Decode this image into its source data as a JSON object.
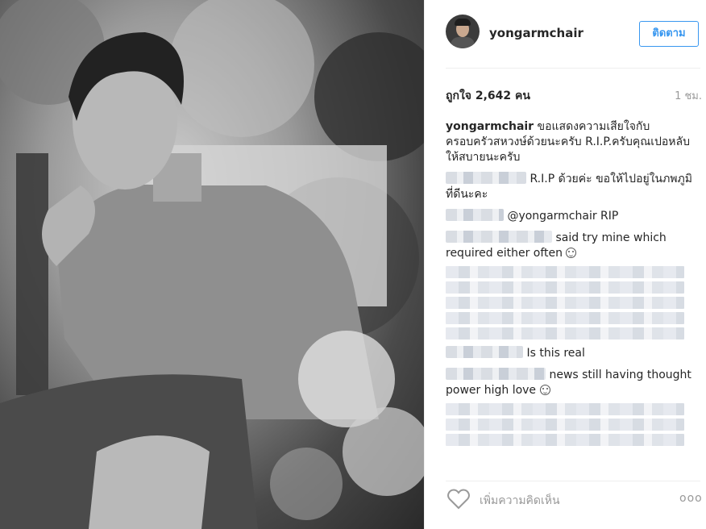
{
  "post": {
    "username": "yongarmchair",
    "follow_label": "ติดตาม",
    "likes": "ถูกใจ 2,642 คน",
    "time": "1 ชม."
  },
  "comments": [
    {
      "username": "yongarmchair",
      "text": "ขอแสดงความเสียใจกับครอบครัวสหวงษ์ด้วยนะครับ R.I.P.ครับคุณเปอหลับให้สบายนะครับ"
    },
    {
      "username": "",
      "text": "R.I.P ด้วยค่ะ ขอให้ไปอยู่ในภพภูมิที่ดีนะคะ"
    },
    {
      "username": "",
      "text": "@yongarmchair RIP"
    },
    {
      "username": "",
      "text": "said try mine which required either often"
    },
    {
      "username": "",
      "text": "Is this real"
    },
    {
      "username": "",
      "text": "news still having thought power high love"
    }
  ],
  "footer": {
    "comment_placeholder": "เพิ่มความคิดเห็น",
    "more_label": "ooo"
  },
  "icons": {
    "heart": "heart-icon",
    "smile": "smile-emoji-icon",
    "more": "more-options-icon"
  }
}
